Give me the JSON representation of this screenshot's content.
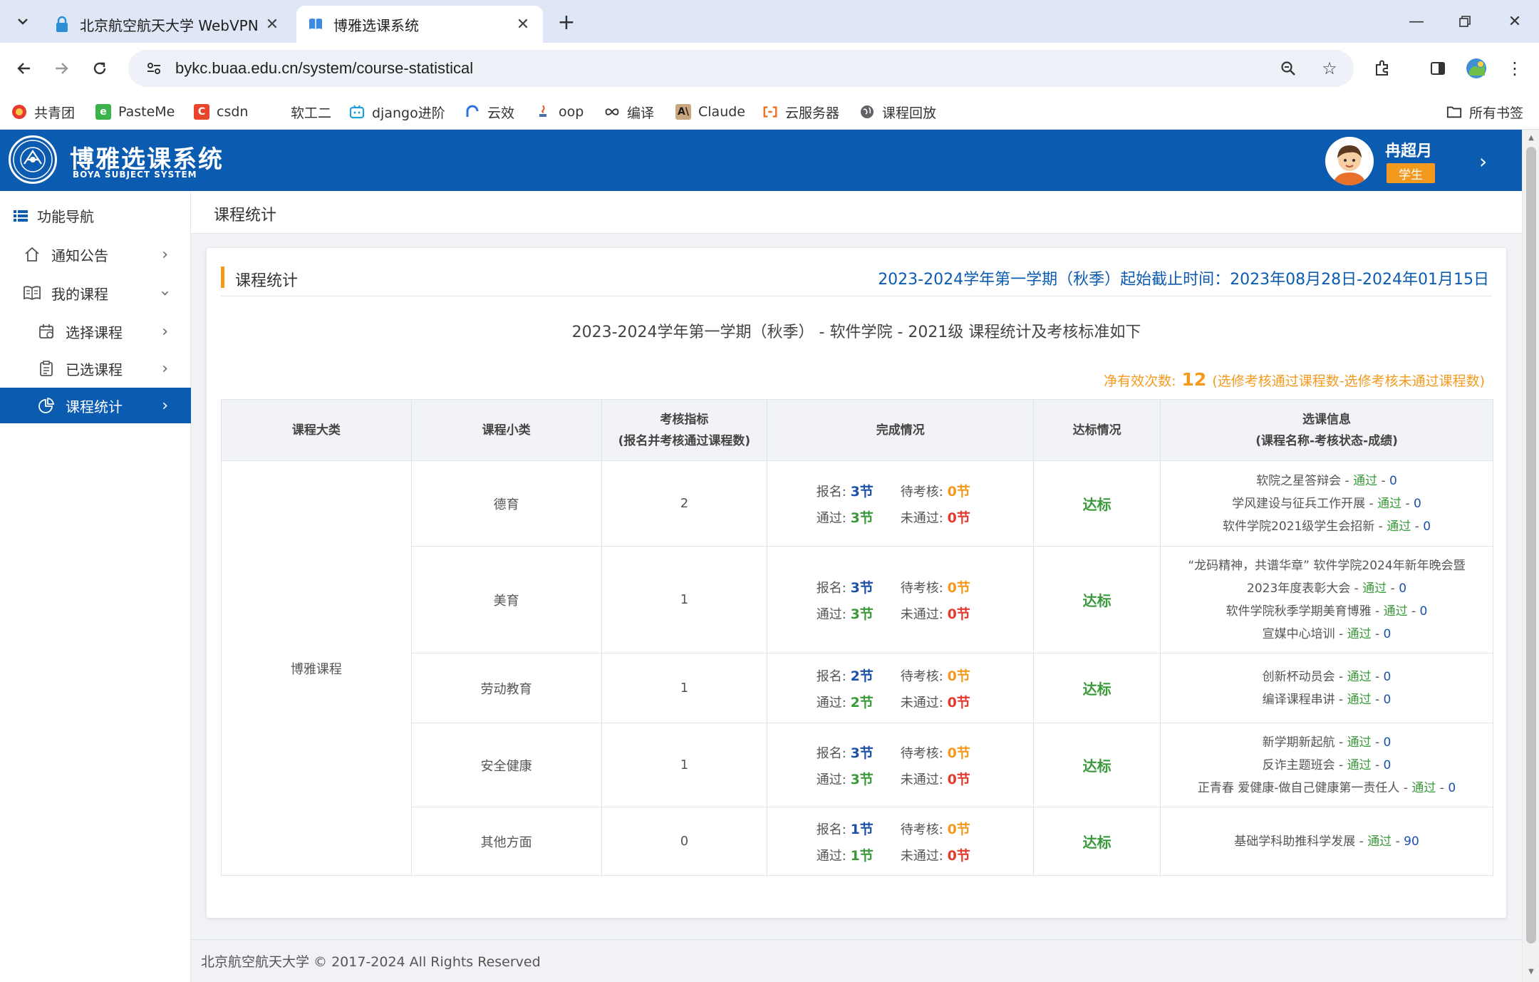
{
  "browser": {
    "tabs": [
      {
        "title": "北京航空航天大学 WebVPN",
        "active": false
      },
      {
        "title": "博雅选课系统",
        "active": true
      }
    ],
    "url": "bykc.buaa.edu.cn/system/course-statistical",
    "bookmarks": [
      {
        "label": "共青团",
        "icon": "youth-league-icon"
      },
      {
        "label": "PasteMe",
        "icon": "pasteme-icon"
      },
      {
        "label": "csdn",
        "icon": "csdn-icon"
      },
      {
        "label": "软工二",
        "icon": "blank-icon"
      },
      {
        "label": "django进阶",
        "icon": "bilibili-icon"
      },
      {
        "label": "云效",
        "icon": "yunxiao-icon"
      },
      {
        "label": "oop",
        "icon": "java-icon"
      },
      {
        "label": "编译",
        "icon": "infinity-icon"
      },
      {
        "label": "Claude",
        "icon": "claude-icon"
      },
      {
        "label": "云服务器",
        "icon": "aliyun-icon"
      },
      {
        "label": "课程回放",
        "icon": "globe-icon"
      }
    ],
    "all_bookmarks": "所有书签"
  },
  "app": {
    "title": "博雅选课系统",
    "subtitle": "BOYA SUBJECT SYSTEM",
    "user": {
      "name": "冉超月",
      "role": "学生"
    }
  },
  "sidebar": {
    "title": "功能导航",
    "items": [
      {
        "label": "通知公告",
        "level": 1,
        "icon": "home-icon",
        "chevron": "right"
      },
      {
        "label": "我的课程",
        "level": 1,
        "icon": "book-icon",
        "chevron": "down"
      },
      {
        "label": "选择课程",
        "level": 2,
        "icon": "calendar-icon",
        "chevron": "right"
      },
      {
        "label": "已选课程",
        "level": 2,
        "icon": "clipboard-icon",
        "chevron": "right"
      },
      {
        "label": "课程统计",
        "level": 2,
        "icon": "pie-chart-icon",
        "chevron": "right",
        "active": true
      }
    ]
  },
  "page": {
    "title": "课程统计",
    "card_title": "课程统计",
    "term_range": "2023-2024学年第一学期（秋季）起始截止时间：2023年08月28日-2024年01月15日",
    "subtitle": "2023-2024学年第一学期（秋季） - 软件学院 - 2021级 课程统计及考核标准如下",
    "net_count_label": "净有效次数:",
    "net_count_value": "12",
    "net_count_formula": "(选修考核通过课程数-选修考核未通过课程数)"
  },
  "table": {
    "headers": {
      "category": "课程大类",
      "subcategory": "课程小类",
      "indicator_line1": "考核指标",
      "indicator_line2": "(报名并考核通过课程数)",
      "completion": "完成情况",
      "status": "达标情况",
      "info_line1": "选课信息",
      "info_line2": "(课程名称-考核状态-成绩)"
    },
    "category": "博雅课程",
    "labels": {
      "enrolled": "报名:",
      "pending": "待考核:",
      "passed": "通过:",
      "failed": "未通过:"
    },
    "rows": [
      {
        "subcategory": "德育",
        "indicator": "2",
        "enrolled": "3节",
        "pending": "0节",
        "passed": "3节",
        "failed": "0节",
        "status": "达标",
        "courses": [
          {
            "name": "软院之星答辩会",
            "state": "通过",
            "score": "0"
          },
          {
            "name": "学风建设与征兵工作开展",
            "state": "通过",
            "score": "0"
          },
          {
            "name": "软件学院2021级学生会招新",
            "state": "通过",
            "score": "0"
          }
        ]
      },
      {
        "subcategory": "美育",
        "indicator": "1",
        "enrolled": "3节",
        "pending": "0节",
        "passed": "3节",
        "failed": "0节",
        "status": "达标",
        "courses": [
          {
            "name": "“龙码精神，共谱华章” 软件学院2024年新年晚会暨",
            "state": "",
            "score": ""
          },
          {
            "name": "2023年度表彰大会",
            "state": "通过",
            "score": "0"
          },
          {
            "name": "软件学院秋季学期美育博雅",
            "state": "通过",
            "score": "0"
          },
          {
            "name": "宣媒中心培训",
            "state": "通过",
            "score": "0"
          }
        ]
      },
      {
        "subcategory": "劳动教育",
        "indicator": "1",
        "enrolled": "2节",
        "pending": "0节",
        "passed": "2节",
        "failed": "0节",
        "status": "达标",
        "courses": [
          {
            "name": "创新杯动员会",
            "state": "通过",
            "score": "0"
          },
          {
            "name": "编译课程串讲",
            "state": "通过",
            "score": "0"
          }
        ]
      },
      {
        "subcategory": "安全健康",
        "indicator": "1",
        "enrolled": "3节",
        "pending": "0节",
        "passed": "3节",
        "failed": "0节",
        "status": "达标",
        "courses": [
          {
            "name": "新学期新起航",
            "state": "通过",
            "score": "0"
          },
          {
            "name": "反诈主题班会",
            "state": "通过",
            "score": "0"
          },
          {
            "name": "正青春 爱健康-做自己健康第一责任人",
            "state": "通过",
            "score": "0"
          }
        ]
      },
      {
        "subcategory": "其他方面",
        "indicator": "0",
        "enrolled": "1节",
        "pending": "0节",
        "passed": "1节",
        "failed": "0节",
        "status": "达标",
        "courses": [
          {
            "name": "基础学科助推科学发展",
            "state": "通过",
            "score": "90"
          }
        ]
      }
    ]
  },
  "footer": "北京航空航天大学 © 2017-2024 All Rights Reserved",
  "colors": {
    "brand": "#0b5bb0",
    "accent": "#f39a1e",
    "pass": "#3a9a3a",
    "fail": "#e23a2c"
  }
}
